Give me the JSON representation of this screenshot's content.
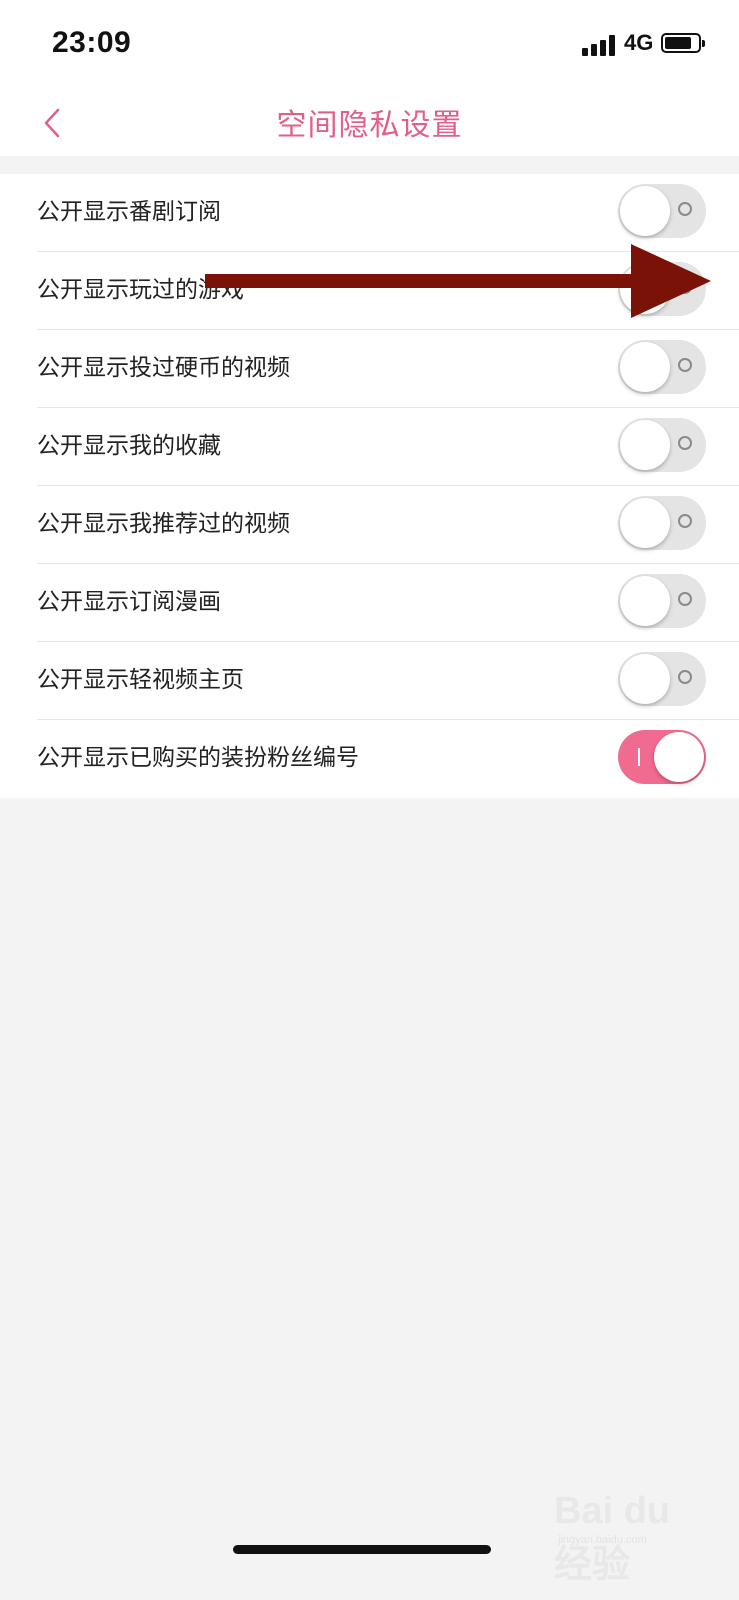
{
  "status_bar": {
    "time": "23:09",
    "network": "4G"
  },
  "header": {
    "title": "空间隐私设置"
  },
  "settings": [
    {
      "label": "公开显示番剧订阅",
      "enabled": false
    },
    {
      "label": "公开显示玩过的游戏",
      "enabled": false
    },
    {
      "label": "公开显示投过硬币的视频",
      "enabled": false
    },
    {
      "label": "公开显示我的收藏",
      "enabled": false
    },
    {
      "label": "公开显示我推荐过的视频",
      "enabled": false
    },
    {
      "label": "公开显示订阅漫画",
      "enabled": false
    },
    {
      "label": "公开显示轻视频主页",
      "enabled": false
    },
    {
      "label": "公开显示已购买的装扮粉丝编号",
      "enabled": true
    }
  ],
  "colors": {
    "accent": "#e0608a",
    "toggle_on": "#f06b8f",
    "annotation_arrow": "#7a1208"
  },
  "watermark": {
    "brand": "Bai du 经验",
    "url": "jingyan.baidu.com"
  }
}
